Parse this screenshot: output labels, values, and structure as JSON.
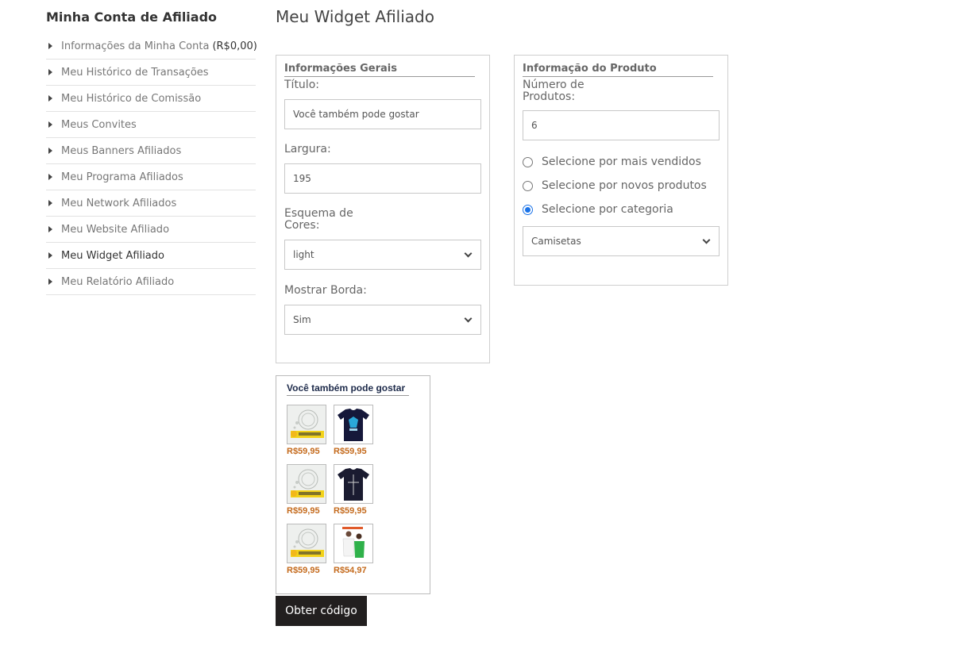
{
  "sidebar": {
    "title": "Minha Conta de Afiliado",
    "items": [
      {
        "label": "Informações da Minha Conta",
        "extra": "(R$0,00)"
      },
      {
        "label": "Meu Histórico de Transações"
      },
      {
        "label": "Meu Histórico de Comissão"
      },
      {
        "label": "Meus Convites"
      },
      {
        "label": "Meus Banners Afiliados"
      },
      {
        "label": "Meu Programa Afiliados"
      },
      {
        "label": "Meu Network Afiliados"
      },
      {
        "label": "Meu Website Afiliado"
      },
      {
        "label": "Meu Widget Afiliado",
        "active": true
      },
      {
        "label": "Meu Relatório Afiliado"
      }
    ]
  },
  "main": {
    "title": "Meu Widget Afiliado",
    "general": {
      "legend": "Informações Gerais",
      "title_label": "Título:",
      "title_value": "Você também pode gostar",
      "width_label": "Largura:",
      "width_value": "195",
      "color_label_1": "Esquema de",
      "color_label_2": "Cores:",
      "color_value": "light",
      "border_label": "Mostrar Borda:",
      "border_value": "Sim"
    },
    "product": {
      "legend": "Informação do Produto",
      "count_label_1": "Número de",
      "count_label_2": "Produtos:",
      "count_value": "6",
      "radios": [
        {
          "label": "Selecione por mais vendidos",
          "checked": false
        },
        {
          "label": "Selecione por novos produtos",
          "checked": false
        },
        {
          "label": "Selecione por categoria",
          "checked": true
        }
      ],
      "category_value": "Camisetas"
    },
    "widget": {
      "title": "Você também pode gostar",
      "products": [
        {
          "price": "R$59,95",
          "image": "placeholder-image"
        },
        {
          "price": "R$59,95",
          "image": "navy-tshirt-image"
        },
        {
          "price": "R$59,95",
          "image": "placeholder-image"
        },
        {
          "price": "R$59,95",
          "image": "navy-tshirt-image"
        },
        {
          "price": "R$59,95",
          "image": "placeholder-image"
        },
        {
          "price": "R$54,97",
          "image": "couple-tshirt-image"
        }
      ]
    },
    "get_code_label": "Obter código"
  }
}
